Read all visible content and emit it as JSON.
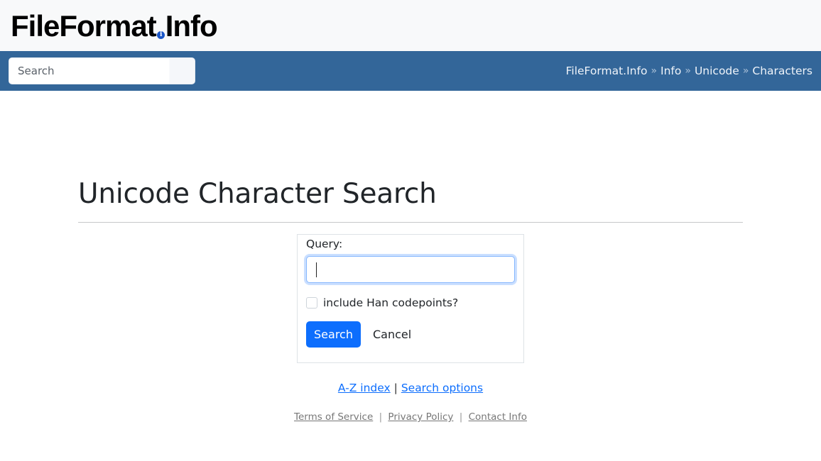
{
  "header": {
    "logo_part1": "FileFormat",
    "logo_icon": "i",
    "logo_part2": "Info"
  },
  "navbar": {
    "search_placeholder": "Search",
    "breadcrumb": [
      {
        "label": "FileFormat.Info"
      },
      {
        "label": "Info"
      },
      {
        "label": "Unicode"
      },
      {
        "label": "Characters"
      }
    ],
    "separator": "»"
  },
  "main": {
    "title": "Unicode Character Search",
    "form": {
      "query_label": "Query:",
      "query_value": "",
      "han_checkbox_label": "include Han codepoints?",
      "han_checked": false,
      "search_button": "Search",
      "cancel_button": "Cancel"
    },
    "links": {
      "az_index": "A-Z index",
      "divider": "|",
      "search_options": "Search options"
    }
  },
  "footer": {
    "terms": "Terms of Service",
    "privacy": "Privacy Policy",
    "contact": "Contact Info",
    "divider": "|"
  },
  "colors": {
    "navbar": "#336699",
    "primary": "#0d6efd"
  }
}
